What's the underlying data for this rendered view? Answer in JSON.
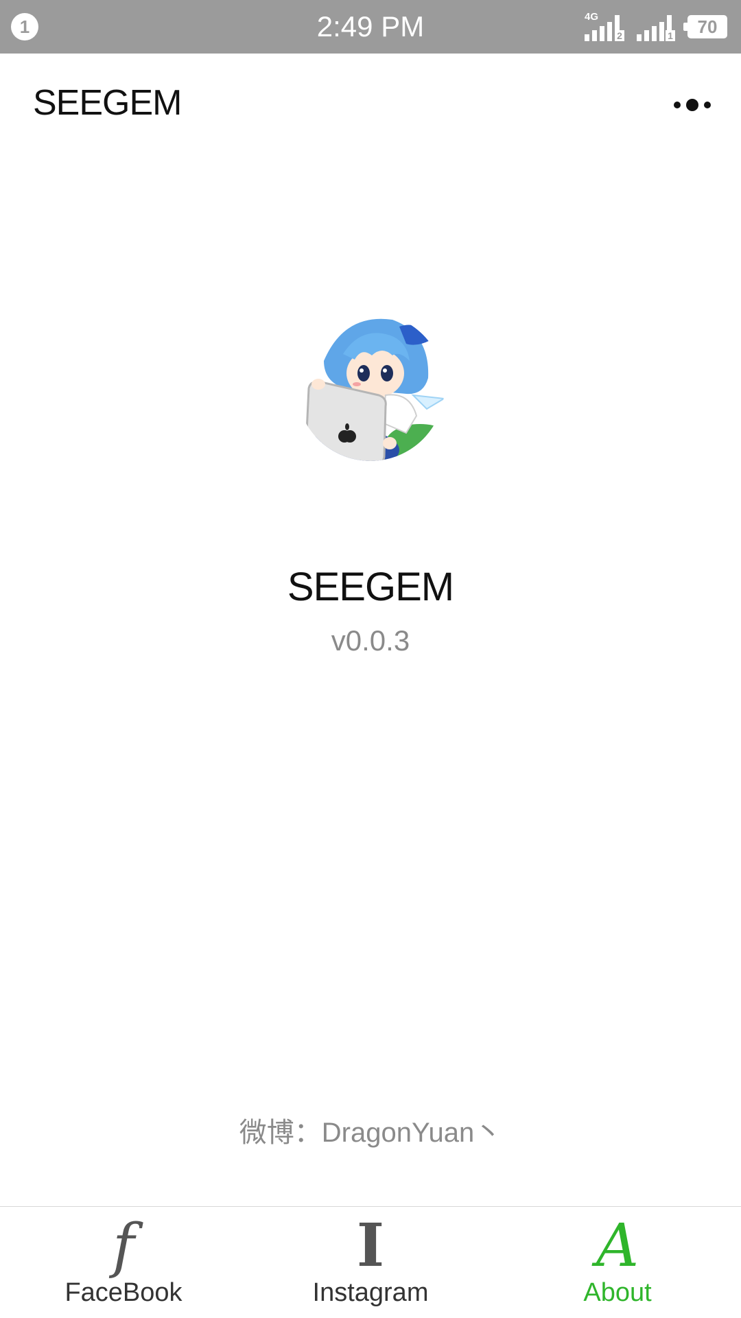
{
  "status_bar": {
    "notification_count": "1",
    "time": "2:49 PM",
    "sim1_network": "4G",
    "sim1_index": "2",
    "sim2_index": "1",
    "battery_level": "70"
  },
  "header": {
    "title": "SEEGEM",
    "more_icon": "more-dots-icon"
  },
  "profile": {
    "avatar_icon": "anime-character-with-tablet-avatar",
    "app_name": "SEEGEM",
    "version": "v0.0.3",
    "weibo": "微博：DragonYuan丶"
  },
  "tabs": [
    {
      "label": "FaceBook",
      "icon_glyph": "f",
      "icon": "facebook-icon",
      "active": false
    },
    {
      "label": "Instagram",
      "icon_glyph": "I",
      "icon": "instagram-icon",
      "active": false
    },
    {
      "label": "About",
      "icon_glyph": "A",
      "icon": "about-icon",
      "active": true
    }
  ],
  "colors": {
    "status_bar_bg": "#9b9b9b",
    "active_tab": "#2fb52b",
    "inactive_tab": "#555555",
    "muted_text": "#8a8a8a"
  }
}
